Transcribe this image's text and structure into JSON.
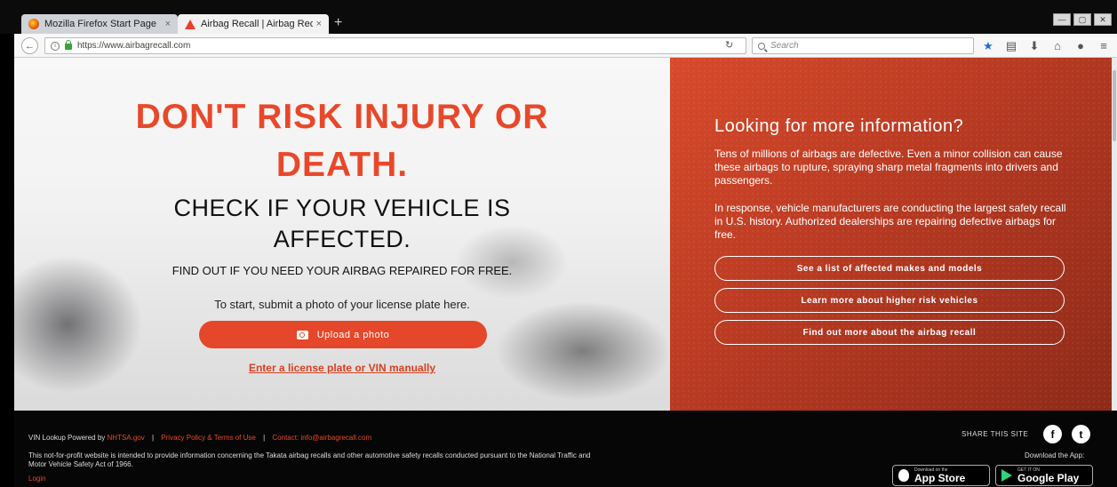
{
  "browser": {
    "tabs": [
      {
        "label": "Mozilla Firefox Start Page",
        "close": "×"
      },
      {
        "label": "Airbag Recall | Airbag Recall",
        "close": "×"
      }
    ],
    "new_tab": "+",
    "window_controls": [
      "—",
      "▢",
      "✕"
    ],
    "url": "https://www.airbagrecall.com",
    "search_placeholder": "Search",
    "icons": [
      "star-icon",
      "reading-list-icon",
      "download-icon",
      "home-icon",
      "chat-icon",
      "menu-icon"
    ]
  },
  "hero": {
    "headline_line1": "DON'T RISK INJURY OR",
    "headline_line2": "DEATH.",
    "subhead_line1": "CHECK IF YOUR VEHICLE IS",
    "subhead_line2": "AFFECTED.",
    "find_out": "FIND OUT IF YOU NEED YOUR AIRBAG REPAIRED FOR FREE.",
    "to_start": "To start, submit a photo of your license plate here.",
    "upload_label": "Upload a photo",
    "manual_link": "Enter a license plate or VIN manually"
  },
  "info": {
    "title": "Looking for more information?",
    "paragraph1": "Tens of millions of airbags are defective. Even a minor collision can cause these airbags to rupture, spraying sharp metal fragments into drivers and passengers.",
    "paragraph2": "In response, vehicle manufacturers are conducting the largest safety recall in U.S. history. Authorized dealerships are repairing defective airbags for free.",
    "buttons": [
      "See a list of affected makes and models",
      "Learn more about higher risk vehicles",
      "Find out more about the airbag recall"
    ]
  },
  "footer": {
    "powered_prefix": "VIN Lookup Powered by",
    "powered_link": "NHTSA.gov",
    "separator": "|",
    "privacy": "Privacy Policy & Terms of Use",
    "contact": "Contact: info@airbagrecall.com",
    "disclaimer": "This not-for-profit website is intended to provide information concerning the Takata airbag recalls and other automotive safety recalls conducted pursuant to the National Traffic and Motor Vehicle Safety Act of 1966.",
    "login": "Login",
    "share_label": "SHARE THIS SITE",
    "facebook_glyph": "f",
    "twitter_glyph": "t",
    "download_label": "Download the App:",
    "appstore_small": "Download on the",
    "appstore_big": "App Store",
    "google_small": "GET IT ON",
    "google_big": "Google Play"
  },
  "colors": {
    "accent": "#e8482a",
    "panel": "#b83a22",
    "footer": "#060606"
  }
}
